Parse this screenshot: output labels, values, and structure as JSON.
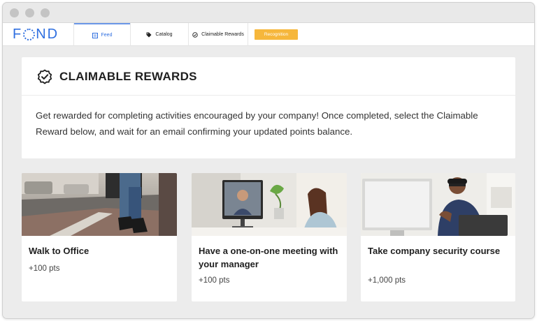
{
  "nav": {
    "logo": "FOND",
    "tabs": [
      {
        "label": "Feed",
        "icon": "feed-icon"
      },
      {
        "label": "Catalog",
        "icon": "tag-icon"
      },
      {
        "label": "Claimable Rewards",
        "icon": "badge-check-icon"
      }
    ],
    "recognition_label": "Recognition"
  },
  "header": {
    "title": "CLAIMABLE REWARDS",
    "icon": "badge-check-icon",
    "description": "Get rewarded for completing activities encouraged by your company! Once completed, select the Claimable Reward below, and wait for an email confirming your updated points balance."
  },
  "rewards": [
    {
      "title": "Walk to Office",
      "points": "+100 pts",
      "image": "walking-feet-photo"
    },
    {
      "title": "Have a one-on-one meeting with your manager",
      "points": "+100 pts",
      "image": "video-call-photo"
    },
    {
      "title": "Take company security course",
      "points": "+1,000 pts",
      "image": "man-at-computer-photo"
    }
  ],
  "colors": {
    "brand": "#2f6fe0",
    "recognition_button": "#f6b73c",
    "background": "#ececec"
  }
}
